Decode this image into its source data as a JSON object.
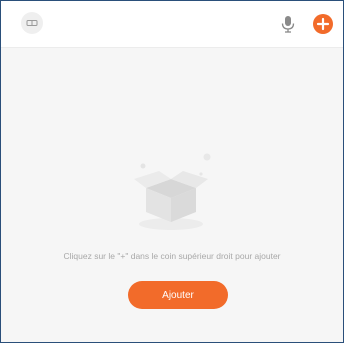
{
  "colors": {
    "accent": "#f26b2a",
    "background": "#f6f6f6",
    "topbar": "#ffffff",
    "muted_text": "#a8a8a8",
    "icon_gray": "#8a8a8a"
  },
  "header": {
    "left_icon": "device-icon",
    "mic_icon": "microphone-icon",
    "add_icon": "plus-circle-icon"
  },
  "empty_state": {
    "illustration": "empty-box-icon",
    "message": "Cliquez sur le \"+\" dans le coin supérieur droit pour ajouter",
    "button_label": "Ajouter"
  }
}
